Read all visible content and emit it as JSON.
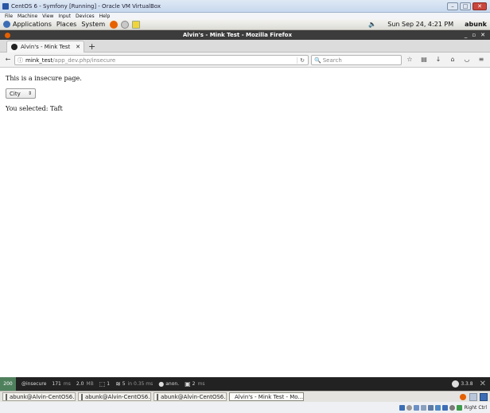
{
  "virtualbox": {
    "title": "CentOS 6 - Symfony [Running] - Oracle VM VirtualBox",
    "menu": [
      "File",
      "Machine",
      "View",
      "Input",
      "Devices",
      "Help"
    ],
    "host_key": "Right Ctrl"
  },
  "gnome_panel": {
    "menus": [
      "Applications",
      "Places",
      "System"
    ],
    "datetime": "Sun Sep 24,  4:21 PM",
    "user": "abunk"
  },
  "firefox": {
    "window_title": "Alvin's - Mink Test - Mozilla Firefox",
    "tab_title": "Alvin's - Mink Test",
    "url_host": "mink_test",
    "url_path": "/app_dev.php/insecure",
    "search_placeholder": "Search"
  },
  "page": {
    "message": "This is a insecure page.",
    "select_value": "City",
    "selected_text": "You selected: Taft"
  },
  "symfony_toolbar": {
    "status_code": "200",
    "route": "@insecure",
    "time_value": "171",
    "time_unit": "ms",
    "memory_value": "2.0",
    "memory_unit": "MB",
    "forms_count": "1",
    "cache_value": "5",
    "cache_detail": "in 0.35 ms",
    "user": "anon.",
    "twig_value": "2",
    "twig_unit": "ms",
    "version": "3.3.8"
  },
  "taskbar": {
    "items": [
      "abunk@Alvin-CentOS6...",
      "abunk@Alvin-CentOS6...",
      "abunk@Alvin-CentOS6...",
      "Alvin's - Mink Test - Mo..."
    ]
  },
  "colors": {
    "symfony_status_ok": "#4f805d",
    "firefox_title_bar": "#3c3c3c"
  }
}
